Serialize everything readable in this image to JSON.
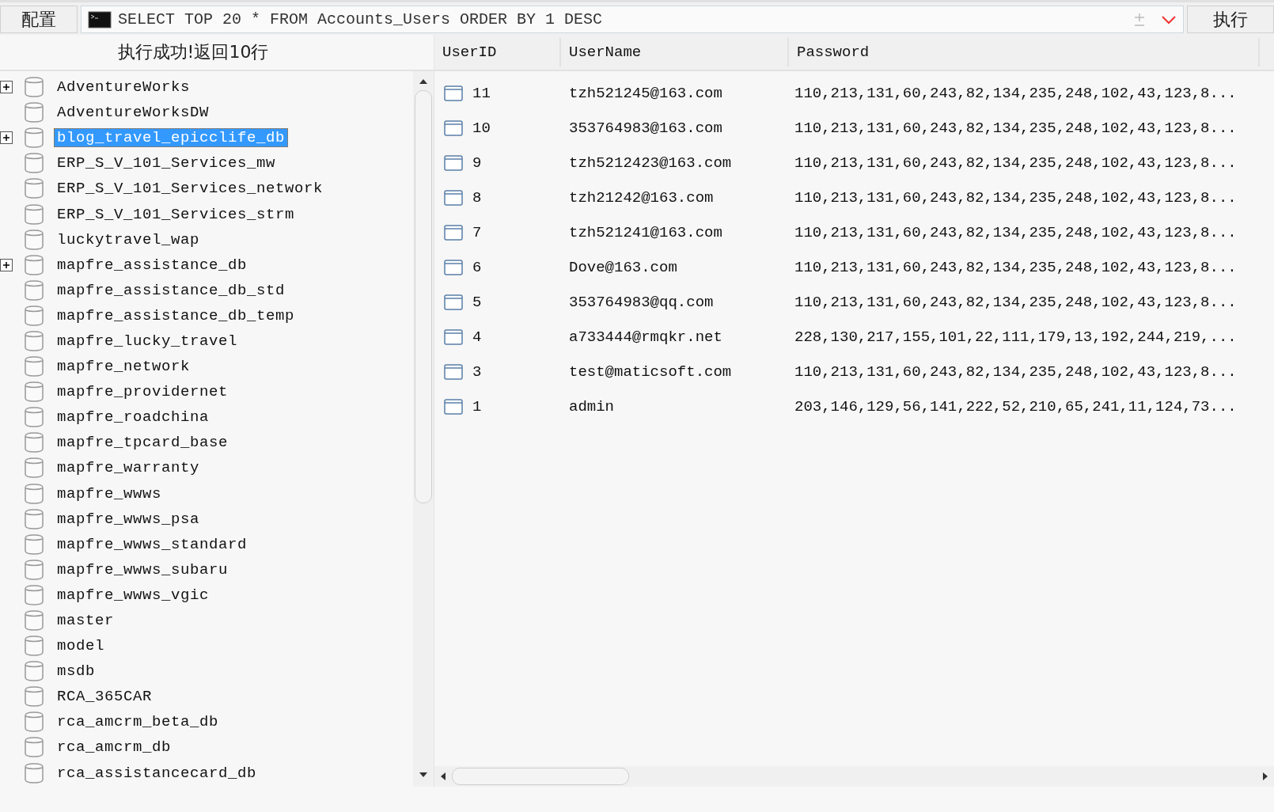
{
  "toolbar": {
    "config_button": "配置",
    "query": "SELECT TOP 20 * FROM Accounts_Users ORDER BY 1 DESC",
    "execute_button": "执行"
  },
  "status": "执行成功!返回10行",
  "databases": [
    {
      "name": "AdventureWorks",
      "expandable": true,
      "selected": false
    },
    {
      "name": "AdventureWorksDW",
      "expandable": false,
      "selected": false
    },
    {
      "name": "blog_travel_epicclife_db",
      "expandable": true,
      "selected": true
    },
    {
      "name": "ERP_S_V_101_Services_mw",
      "expandable": false,
      "selected": false
    },
    {
      "name": "ERP_S_V_101_Services_network",
      "expandable": false,
      "selected": false
    },
    {
      "name": "ERP_S_V_101_Services_strm",
      "expandable": false,
      "selected": false
    },
    {
      "name": "luckytravel_wap",
      "expandable": false,
      "selected": false
    },
    {
      "name": "mapfre_assistance_db",
      "expandable": true,
      "selected": false
    },
    {
      "name": "mapfre_assistance_db_std",
      "expandable": false,
      "selected": false
    },
    {
      "name": "mapfre_assistance_db_temp",
      "expandable": false,
      "selected": false
    },
    {
      "name": "mapfre_lucky_travel",
      "expandable": false,
      "selected": false
    },
    {
      "name": "mapfre_network",
      "expandable": false,
      "selected": false
    },
    {
      "name": "mapfre_providernet",
      "expandable": false,
      "selected": false
    },
    {
      "name": "mapfre_roadchina",
      "expandable": false,
      "selected": false
    },
    {
      "name": "mapfre_tpcard_base",
      "expandable": false,
      "selected": false
    },
    {
      "name": "mapfre_warranty",
      "expandable": false,
      "selected": false
    },
    {
      "name": "mapfre_wwws",
      "expandable": false,
      "selected": false
    },
    {
      "name": "mapfre_wwws_psa",
      "expandable": false,
      "selected": false
    },
    {
      "name": "mapfre_wwws_standard",
      "expandable": false,
      "selected": false
    },
    {
      "name": "mapfre_wwws_subaru",
      "expandable": false,
      "selected": false
    },
    {
      "name": "mapfre_wwws_vgic",
      "expandable": false,
      "selected": false
    },
    {
      "name": "master",
      "expandable": false,
      "selected": false
    },
    {
      "name": "model",
      "expandable": false,
      "selected": false
    },
    {
      "name": "msdb",
      "expandable": false,
      "selected": false
    },
    {
      "name": "RCA_365CAR",
      "expandable": false,
      "selected": false
    },
    {
      "name": "rca_amcrm_beta_db",
      "expandable": false,
      "selected": false
    },
    {
      "name": "rca_amcrm_db",
      "expandable": false,
      "selected": false
    },
    {
      "name": "rca_assistancecard_db",
      "expandable": false,
      "selected": false
    }
  ],
  "table": {
    "columns": [
      "UserID",
      "UserName",
      "Password"
    ],
    "rows": [
      [
        "11",
        "tzh521245@163.com",
        "110,213,131,60,243,82,134,235,248,102,43,123,8..."
      ],
      [
        "10",
        "353764983@163.com",
        "110,213,131,60,243,82,134,235,248,102,43,123,8..."
      ],
      [
        "9",
        "tzh5212423@163.com",
        "110,213,131,60,243,82,134,235,248,102,43,123,8..."
      ],
      [
        "8",
        "tzh21242@163.com",
        "110,213,131,60,243,82,134,235,248,102,43,123,8..."
      ],
      [
        "7",
        "tzh521241@163.com",
        "110,213,131,60,243,82,134,235,248,102,43,123,8..."
      ],
      [
        "6",
        "Dove@163.com",
        "110,213,131,60,243,82,134,235,248,102,43,123,8..."
      ],
      [
        "5",
        "353764983@qq.com",
        "110,213,131,60,243,82,134,235,248,102,43,123,8..."
      ],
      [
        "4",
        "a733444@rmqkr.net",
        "228,130,217,155,101,22,111,179,13,192,244,219,..."
      ],
      [
        "3",
        "test@maticsoft.com",
        "110,213,131,60,243,82,134,235,248,102,43,123,8..."
      ],
      [
        "1",
        "admin",
        "203,146,129,56,141,222,52,210,65,241,11,124,73..."
      ]
    ]
  }
}
